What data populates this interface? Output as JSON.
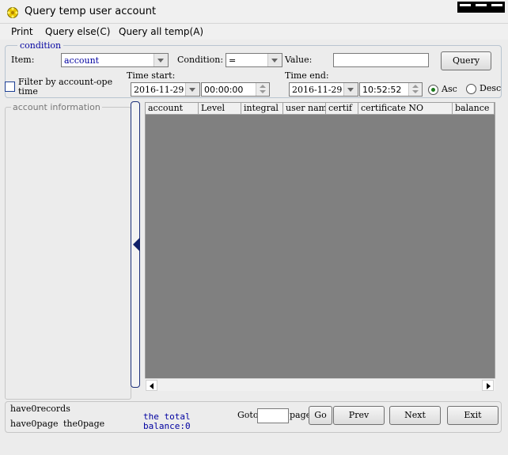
{
  "window": {
    "title": "Query temp user account",
    "icon": "gear-flower-icon"
  },
  "menu": {
    "items": [
      "Print",
      "Query else(C)",
      "Query all temp(A)"
    ]
  },
  "condition": {
    "legend": "condition",
    "item_label": "Item:",
    "item_value": "account",
    "condition_label": "Condition:",
    "condition_value": "=",
    "value_label": "Value:",
    "value_text": "",
    "query_button": "Query",
    "filter_label_1": "Filter by account-ope",
    "filter_label_2": "time",
    "filter_checked": false,
    "time_start_label": "Time start:",
    "time_start_date": "2016-11-29",
    "time_start_time": "00:00:00",
    "time_end_label": "Time end:",
    "time_end_date": "2016-11-29",
    "time_end_time": "10:52:52",
    "asc_label": "Asc",
    "desc_label": "Desc",
    "sort": "Asc"
  },
  "account_info": {
    "legend": "account information"
  },
  "grid": {
    "columns": [
      "account",
      "Level",
      "integral",
      "user nam",
      "certif",
      "certificate NO",
      "balance"
    ],
    "rows": []
  },
  "footer": {
    "records": "have0records",
    "pages": "have0page",
    "current": "the0page",
    "total_1": "the total",
    "total_2": "balance:0",
    "goto_label": "Goto",
    "goto_value": "",
    "page_label": "page",
    "go": "Go",
    "prev": "Prev",
    "next": "Next",
    "exit": "Exit"
  },
  "colors": {
    "accent_text": "#0000a0",
    "grid_bg": "#808080",
    "radio_on": "#1b7a1b"
  }
}
